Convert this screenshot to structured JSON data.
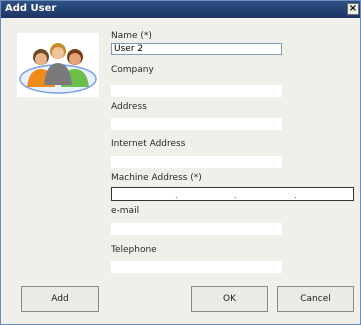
{
  "window": {
    "title": "Add User",
    "close_label": "×"
  },
  "form": {
    "name_label": "Name (*)",
    "name_value": "User 2",
    "company_label": "Company",
    "company_value": "",
    "address_label": "Address",
    "address_value": "",
    "internet_address_label": "Internet Address",
    "internet_address_value": "",
    "machine_address_label": "Machine Address (*)",
    "machine_address_separator": ".",
    "email_label": "e-mail",
    "email_value": "",
    "telephone_label": "Telephone",
    "telephone_value": ""
  },
  "buttons": {
    "add": "Add",
    "ok": "OK",
    "cancel": "Cancel"
  },
  "icons": {
    "avatar": "users-group-icon"
  }
}
